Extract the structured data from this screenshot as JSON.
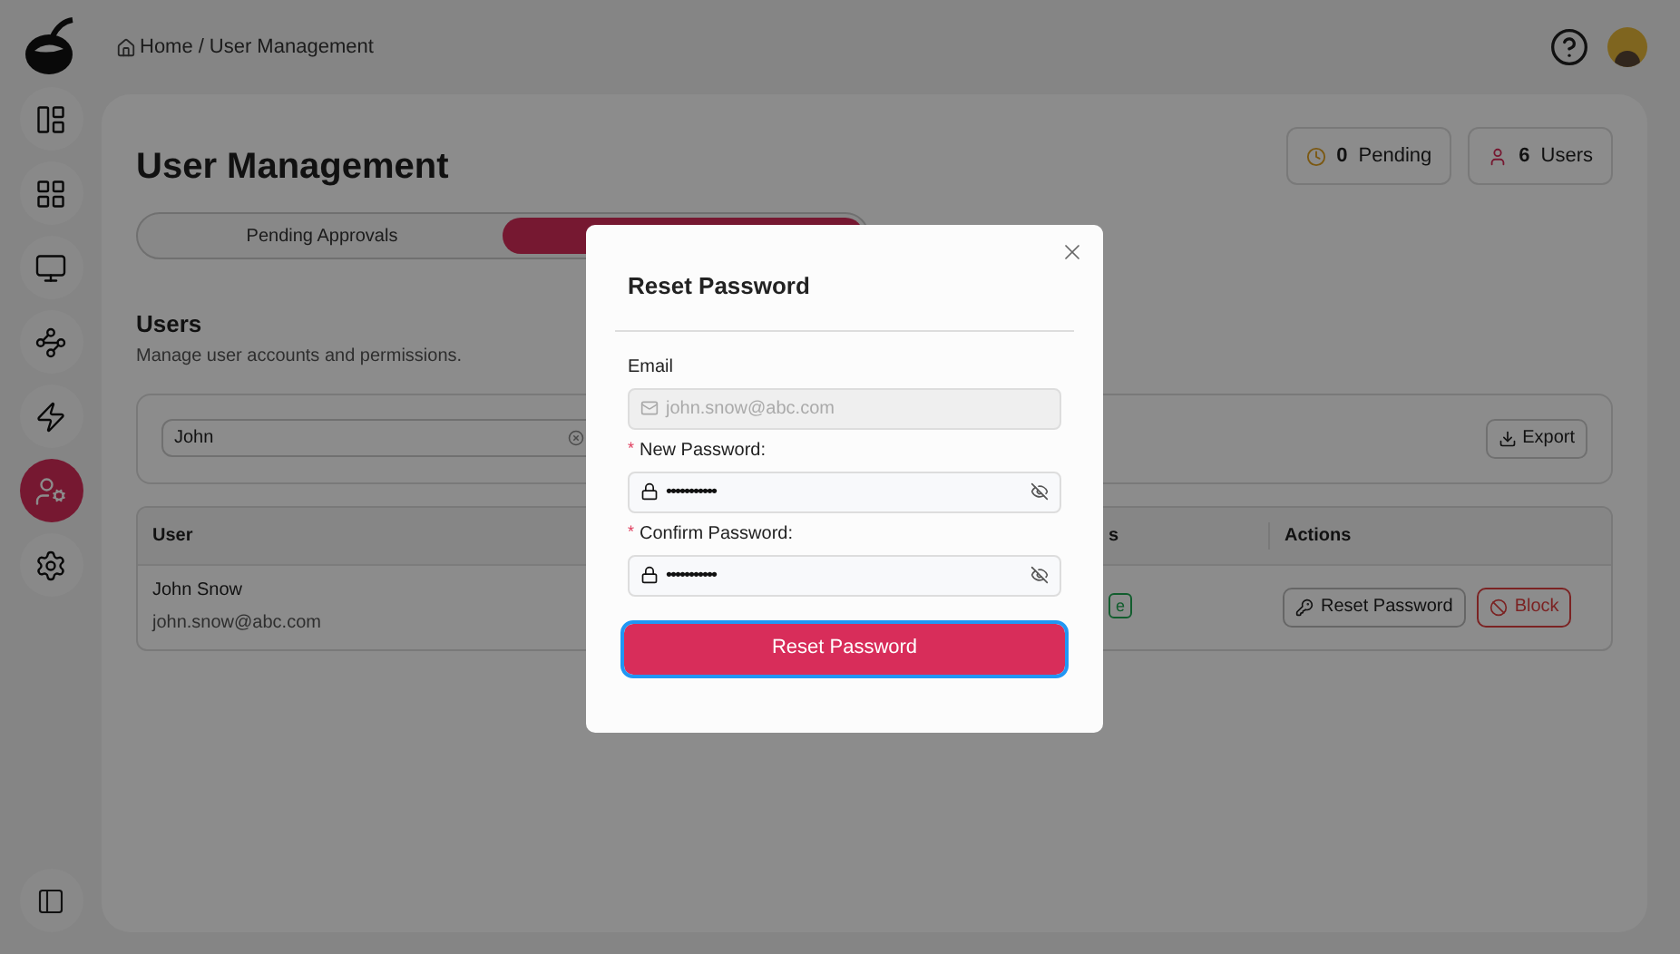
{
  "sidebar": {
    "items": [
      {
        "selected": false
      },
      {
        "selected": false
      },
      {
        "selected": false
      },
      {
        "selected": false
      },
      {
        "selected": false
      },
      {
        "selected": true
      },
      {
        "selected": false
      }
    ]
  },
  "breadcrumb": {
    "items": [
      "Home",
      "User Management"
    ],
    "separator": "/"
  },
  "page": {
    "title": "User Management",
    "stats": [
      {
        "kind": "pending",
        "count": "0",
        "label": "Pending"
      },
      {
        "kind": "users",
        "count": "6",
        "label": "Users"
      }
    ],
    "tabs": [
      {
        "label": "Pending Approvals",
        "selected": false
      },
      {
        "selected": true
      }
    ],
    "section": {
      "title": "Users",
      "subtitle": "Manage user accounts and permissions."
    },
    "search": {
      "value": "John"
    },
    "export": "Export",
    "table": {
      "columns": [
        "User",
        "s",
        "Actions"
      ],
      "rows": [
        {
          "name": "John Snow",
          "email": "john.snow@abc.com",
          "status": "e",
          "actions": [
            "Reset Password",
            "Block"
          ]
        }
      ]
    }
  },
  "dialog": {
    "title": "Reset Password",
    "fields": [
      {
        "kind": "email",
        "label": "Email",
        "value": "john.snow@abc.com",
        "disabled": true
      },
      {
        "kind": "password",
        "required_mark": "*",
        "label": "New Password:",
        "value": "•••••••••••",
        "disabled": false
      },
      {
        "kind": "password",
        "required_mark": "*",
        "label": "Confirm Password:",
        "value": "•••••••••••",
        "disabled": false
      }
    ],
    "submit": "Reset Password"
  }
}
